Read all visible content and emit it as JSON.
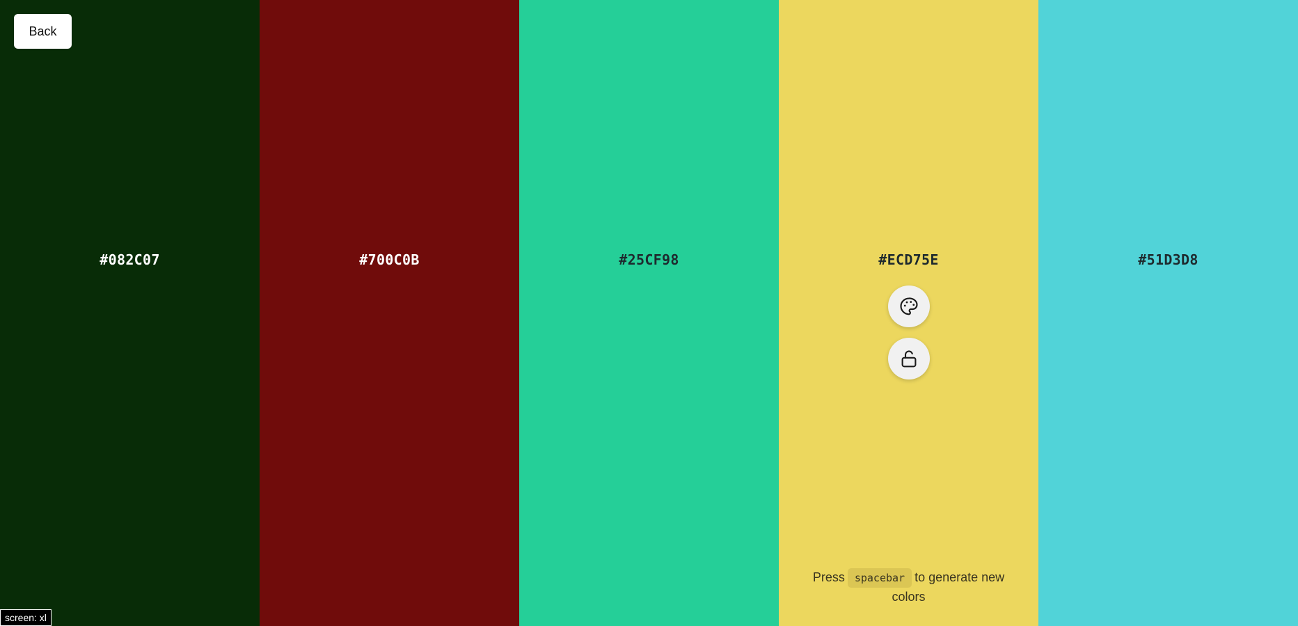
{
  "nav": {
    "back_label": "Back"
  },
  "swatches": [
    {
      "hex": "#082C07",
      "color": "#082C07",
      "text_tone": "dark"
    },
    {
      "hex": "#700C0B",
      "color": "#700C0B",
      "text_tone": "dark"
    },
    {
      "hex": "#25CF98",
      "color": "#25CF98",
      "text_tone": "light"
    },
    {
      "hex": "#ECD75E",
      "color": "#ECD75E",
      "text_tone": "light"
    },
    {
      "hex": "#51D3D8",
      "color": "#51D3D8",
      "text_tone": "light"
    }
  ],
  "active_swatch_controls": {
    "palette_icon": "palette-icon",
    "lock_icon": "unlock-icon"
  },
  "hint": {
    "prefix": "Press",
    "key": "spacebar",
    "suffix_line1": "to generate new",
    "suffix_line2": "colors"
  },
  "debug": {
    "screen_label": "screen: xl"
  }
}
